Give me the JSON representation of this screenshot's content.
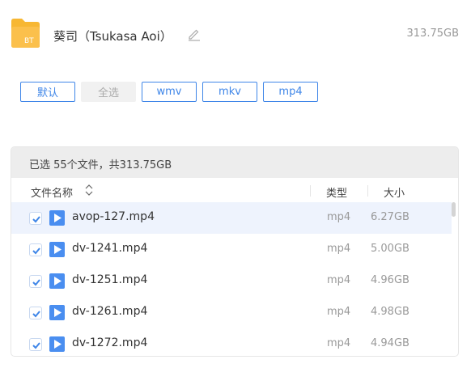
{
  "header": {
    "folder_icon": "bt-folder-icon",
    "title": "葵司（Tsukasa Aoi）",
    "edit_icon": "pencil-icon",
    "total_size": "313.75GB"
  },
  "filters": [
    {
      "label": "默认",
      "disabled": false
    },
    {
      "label": "全选",
      "disabled": true
    },
    {
      "label": "wmv",
      "disabled": false
    },
    {
      "label": "mkv",
      "disabled": false
    },
    {
      "label": "mp4",
      "disabled": false
    }
  ],
  "summary": "已选 55个文件，共313.75GB",
  "columns": {
    "name": "文件名称",
    "type": "类型",
    "size": "大小"
  },
  "files": [
    {
      "name": "avop-127.mp4",
      "type": "mp4",
      "size": "6.27GB",
      "checked": true
    },
    {
      "name": "dv-1241.mp4",
      "type": "mp4",
      "size": "5.00GB",
      "checked": true
    },
    {
      "name": "dv-1251.mp4",
      "type": "mp4",
      "size": "4.96GB",
      "checked": true
    },
    {
      "name": "dv-1261.mp4",
      "type": "mp4",
      "size": "4.98GB",
      "checked": true
    },
    {
      "name": "dv-1272.mp4",
      "type": "mp4",
      "size": "4.94GB",
      "checked": true
    }
  ],
  "colors": {
    "accent": "#3f86e8",
    "folder": "#f7b733",
    "play": "#4a8ef0"
  }
}
